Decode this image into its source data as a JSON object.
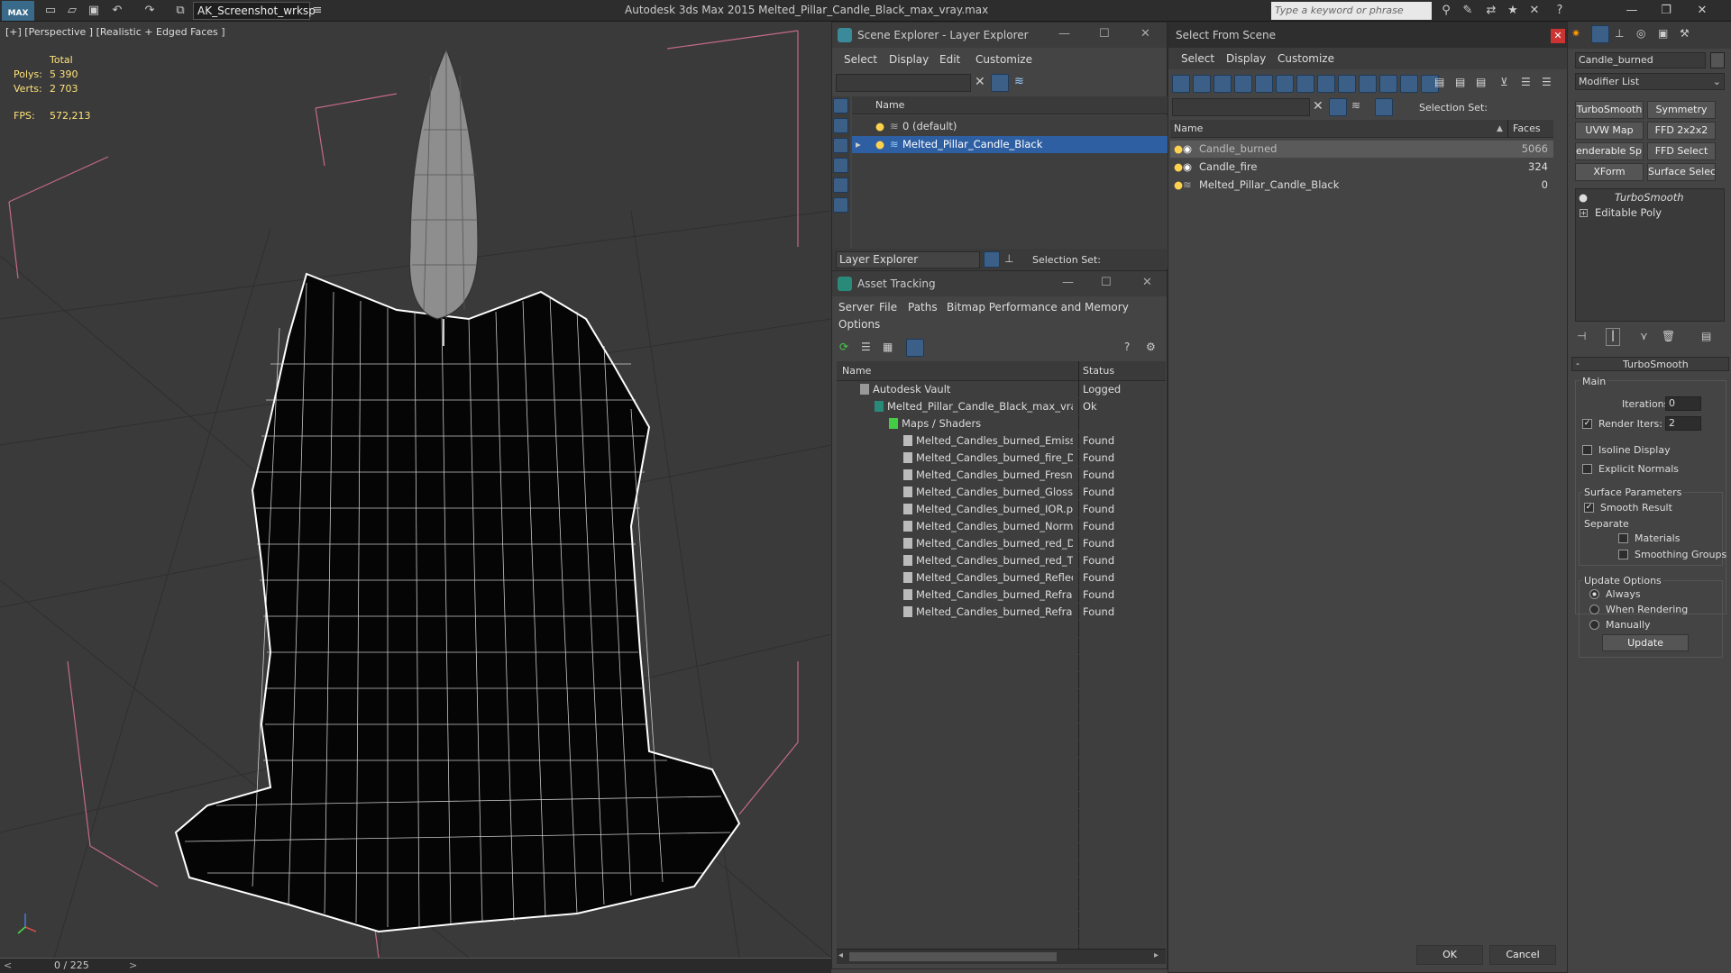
{
  "titlebar": {
    "logo": "MAX",
    "workspace": "AK_Screenshot_wrksp",
    "app_title": "Autodesk 3ds Max  2015    Melted_Pillar_Candle_Black_max_vray.max",
    "search_placeholder": "Type a keyword or phrase"
  },
  "viewport": {
    "label": "[+] [Perspective ] [Realistic + Edged Faces ]",
    "stats": {
      "total": "Total",
      "polys_label": "Polys:",
      "polys": "5 390",
      "verts_label": "Verts:",
      "verts": "2 703",
      "fps_label": "FPS:",
      "fps": "572,213"
    },
    "time_slider": "0 / 225",
    "prev": "<",
    "next": ">"
  },
  "scene_explorer": {
    "title": "Scene Explorer - Layer Explorer",
    "menu": [
      "Select",
      "Display",
      "Edit",
      "Customize"
    ],
    "col_name": "Name",
    "layers": [
      {
        "name": "0 (default)",
        "selected": false
      },
      {
        "name": "Melted_Pillar_Candle_Black",
        "selected": true
      }
    ],
    "footer_dropdown": "Layer Explorer",
    "selection_set_label": "Selection Set:"
  },
  "asset_tracking": {
    "title": "Asset Tracking",
    "menu": [
      "Server",
      "File",
      "Paths",
      "Bitmap Performance and Memory",
      "Options"
    ],
    "col_name": "Name",
    "col_status": "Status",
    "rows": [
      {
        "name": "Autodesk Vault",
        "status": "Logged",
        "indent": 0
      },
      {
        "name": "Melted_Pillar_Candle_Black_max_vray.max",
        "status": "Ok",
        "indent": 1
      },
      {
        "name": "Maps / Shaders",
        "status": "",
        "indent": 2
      },
      {
        "name": "Melted_Candles_burned_Emission.png",
        "status": "Found",
        "indent": 3
      },
      {
        "name": "Melted_Candles_burned_fire_Diffuse.png",
        "status": "Found",
        "indent": 3
      },
      {
        "name": "Melted_Candles_burned_Fresnel.png",
        "status": "Found",
        "indent": 3
      },
      {
        "name": "Melted_Candles_burned_Glossiness.png",
        "status": "Found",
        "indent": 3
      },
      {
        "name": "Melted_Candles_burned_IOR.png",
        "status": "Found",
        "indent": 3
      },
      {
        "name": "Melted_Candles_burned_Normal.png",
        "status": "Found",
        "indent": 3
      },
      {
        "name": "Melted_Candles_burned_red_Diffuse.png",
        "status": "Found",
        "indent": 3
      },
      {
        "name": "Melted_Candles_burned_red_Translucency...",
        "status": "Found",
        "indent": 3
      },
      {
        "name": "Melted_Candles_burned_Reflection.png",
        "status": "Found",
        "indent": 3
      },
      {
        "name": "Melted_Candles_burned_Refract.png",
        "status": "Found",
        "indent": 3
      },
      {
        "name": "Melted_Candles_burned_Refract_Gloss.png",
        "status": "Found",
        "indent": 3
      }
    ]
  },
  "select_from_scene": {
    "title": "Select From Scene",
    "menu": [
      "Select",
      "Display",
      "Customize"
    ],
    "selection_set_label": "Selection Set:",
    "col_name": "Name",
    "col_faces": "Faces",
    "rows": [
      {
        "name": "Candle_burned",
        "faces": "5066",
        "selected": true
      },
      {
        "name": "Candle_fire",
        "faces": "324",
        "selected": false
      },
      {
        "name": "Melted_Pillar_Candle_Black",
        "faces": "0",
        "selected": false
      }
    ],
    "ok": "OK",
    "cancel": "Cancel"
  },
  "command_panel": {
    "object_name": "Candle_burned",
    "modifier_list": "Modifier List",
    "buttons": [
      "TurboSmooth",
      "Symmetry",
      "UVW Map",
      "FFD 2x2x2",
      "enderable Splin",
      "FFD Select",
      "XForm",
      "Surface Select"
    ],
    "stack": [
      {
        "name": "TurboSmooth",
        "italic": true
      },
      {
        "name": "Editable Poly",
        "italic": false
      }
    ],
    "rollout": {
      "title": "TurboSmooth",
      "main": "Main",
      "iterations_label": "Iterations:",
      "iterations": "0",
      "render_iters_label": "Render Iters:",
      "render_iters": "2",
      "isoline": "Isoline Display",
      "explicit_normals": "Explicit Normals",
      "surface_params": "Surface Parameters",
      "smooth_result": "Smooth Result",
      "separate": "Separate",
      "materials": "Materials",
      "smoothing_groups": "Smoothing Groups",
      "update_options": "Update Options",
      "always": "Always",
      "when_rendering": "When Rendering",
      "manually": "Manually",
      "update": "Update"
    }
  },
  "colors": {
    "selection_blue": "#2e5fa3",
    "stat_yellow": "#ffe27a",
    "grid_pink": "#c46a8a"
  }
}
